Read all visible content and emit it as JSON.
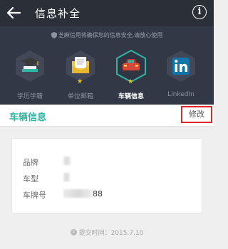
{
  "header": {
    "title": "信息补全",
    "info_glyph": "i"
  },
  "notice": "芝麻信用将确保您的信息安全,请放心使用",
  "categories": [
    {
      "label": "学历学籍",
      "icon": "graduation-cap-icon",
      "starred": false,
      "active": false
    },
    {
      "label": "单位邮箱",
      "icon": "mail-icon",
      "starred": true,
      "active": false
    },
    {
      "label": "车辆信息",
      "icon": "car-icon",
      "starred": true,
      "active": true
    },
    {
      "label": "LinkedIn",
      "icon": "linkedin-icon",
      "starred": false,
      "active": false
    }
  ],
  "section": {
    "title": "车辆信息",
    "edit_label": "修改"
  },
  "vehicle": {
    "brand_label": "品牌",
    "model_label": "车型",
    "plate_label": "车牌号",
    "plate_suffix": "88"
  },
  "footer": {
    "submit_time": "提交时间：2015.7.10"
  },
  "colors": {
    "accent": "#2fb5a3",
    "appbar": "#2b2f38",
    "hero": "#333846",
    "highlight": "#e0262b",
    "star": "#f5c518"
  }
}
